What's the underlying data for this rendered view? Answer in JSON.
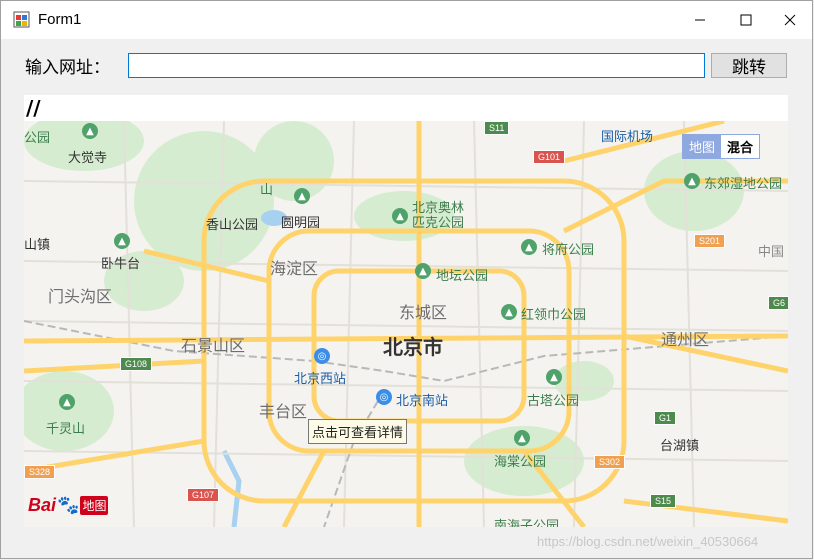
{
  "window": {
    "title": "Form1",
    "icons": [
      "app-icon",
      "minimize-icon",
      "maximize-icon",
      "close-icon"
    ]
  },
  "toolbar": {
    "url_label": "输入网址：",
    "url_value": "",
    "go_label": "跳转"
  },
  "status": {
    "text": "//"
  },
  "map": {
    "type_buttons": [
      "地图",
      "混合"
    ],
    "tooltip": "点击可查看详情",
    "logo": {
      "brand": "Bai",
      "suffix": "地图"
    },
    "districts": [
      "海淀区",
      "东城区",
      "石景山区",
      "丰台区",
      "通州区",
      "门头沟区",
      "北京市"
    ],
    "pois": [
      "公园",
      "大觉寺",
      "香山公园",
      "圆明园",
      "北京奥林匹克公园",
      "将府公园",
      "地坛公园",
      "红领巾公园",
      "卧牛台",
      "北京西站",
      "北京南站",
      "古塔公园",
      "千灵山",
      "海棠公园",
      "台湖镇",
      "东郊湿地公园",
      "国际机场",
      "中国",
      "山",
      "山镇",
      "南海子公园"
    ],
    "highways": [
      "S11",
      "G101",
      "S201",
      "G108",
      "G1",
      "S302",
      "S328",
      "G107",
      "S15",
      "G6"
    ]
  },
  "watermark": "https://blog.csdn.net/weixin_40530664",
  "colors": {
    "accent": "#0078d7",
    "road": "#ffd36b",
    "park": "#d6ecd0",
    "water": "#a8d0f0",
    "brand": "#d0021b"
  }
}
